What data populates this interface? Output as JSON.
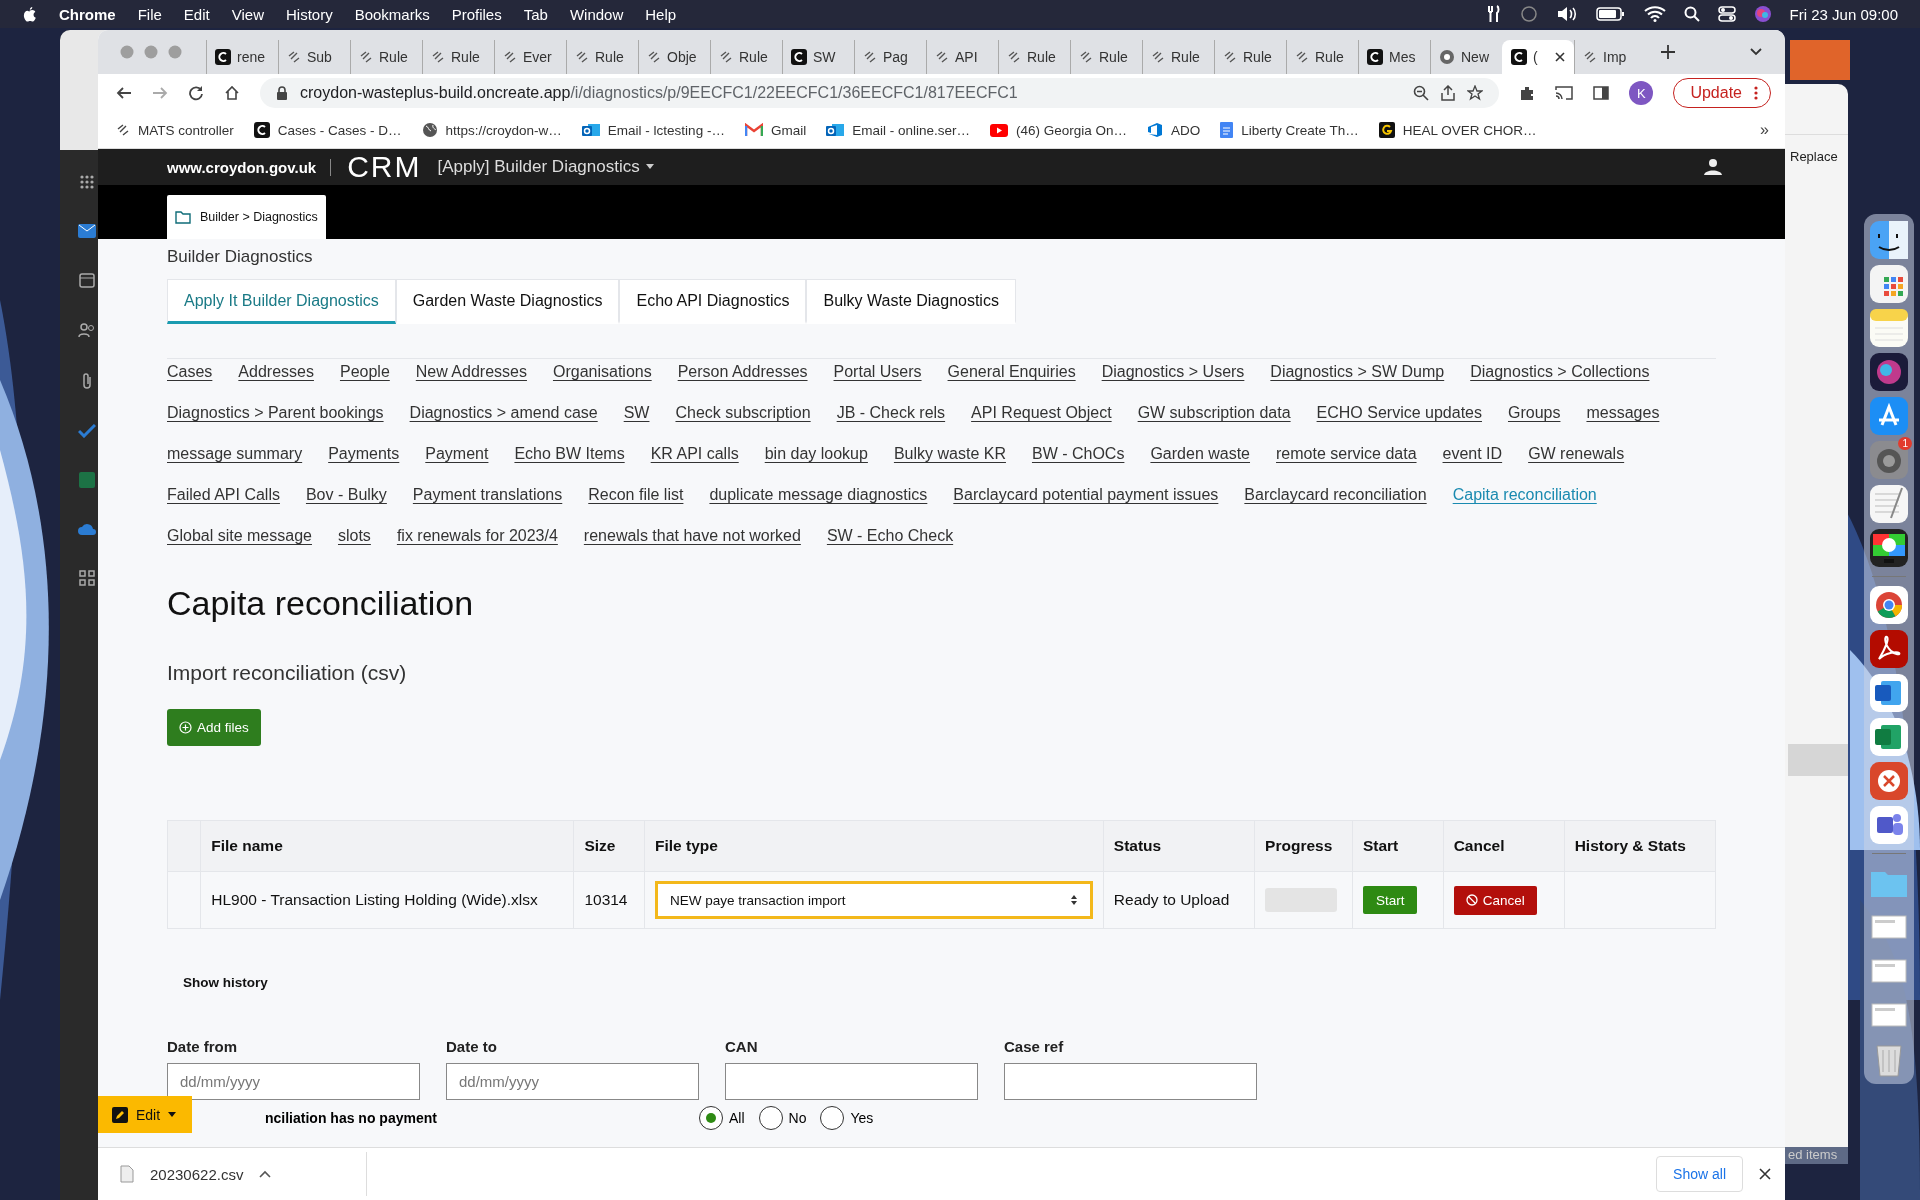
{
  "menu_bar": {
    "app": "Chrome",
    "items": [
      "File",
      "Edit",
      "View",
      "History",
      "Bookmarks",
      "Profiles",
      "Tab",
      "Window",
      "Help"
    ],
    "clock": "Fri 23 Jun  09:00"
  },
  "browser": {
    "tabs": [
      {
        "title": "rene",
        "kind": "c",
        "selected": false
      },
      {
        "title": "Sub",
        "kind": "rule",
        "selected": false
      },
      {
        "title": "Rule",
        "kind": "rule",
        "selected": false
      },
      {
        "title": "Rule",
        "kind": "rule",
        "selected": false
      },
      {
        "title": "Ever",
        "kind": "rule",
        "selected": false
      },
      {
        "title": "Rule",
        "kind": "rule",
        "selected": false
      },
      {
        "title": "Obje",
        "kind": "rule",
        "selected": false
      },
      {
        "title": "Rule",
        "kind": "rule",
        "selected": false
      },
      {
        "title": "SW",
        "kind": "c",
        "selected": false
      },
      {
        "title": "Pag",
        "kind": "rule",
        "selected": false
      },
      {
        "title": "API",
        "kind": "rule",
        "selected": false
      },
      {
        "title": "Rule",
        "kind": "rule",
        "selected": false
      },
      {
        "title": "Rule",
        "kind": "rule",
        "selected": false
      },
      {
        "title": "Rule",
        "kind": "rule",
        "selected": false
      },
      {
        "title": "Rule",
        "kind": "rule",
        "selected": false
      },
      {
        "title": "Rule",
        "kind": "rule",
        "selected": false
      },
      {
        "title": "Mes",
        "kind": "c",
        "selected": false
      },
      {
        "title": "New",
        "kind": "chrome",
        "selected": false
      },
      {
        "title": "(",
        "kind": "c",
        "selected": true
      },
      {
        "title": "Imp",
        "kind": "rule",
        "selected": false
      }
    ],
    "url_host": "croydon-wasteplus-build.oncreate.app",
    "url_path": "/i/diagnostics/p/9EECFC1/22EECFC1/36EECFC1/817EECFC1",
    "profile": "K",
    "update": "Update",
    "bookmarks": [
      {
        "title": "MATS controller",
        "kind": "rule"
      },
      {
        "title": "Cases - Cases - D…",
        "kind": "c"
      },
      {
        "title": "https://croydon-w…",
        "kind": "globe"
      },
      {
        "title": "Email - lctesting -…",
        "kind": "outlook"
      },
      {
        "title": "Gmail",
        "kind": "gmail"
      },
      {
        "title": "Email - online.ser…",
        "kind": "outlook"
      },
      {
        "title": "(46) Georgia On…",
        "kind": "youtube"
      },
      {
        "title": "ADO",
        "kind": "devops"
      },
      {
        "title": "Liberty Create Th…",
        "kind": "doc"
      },
      {
        "title": "HEAL OVER CHOR…",
        "kind": "g"
      }
    ],
    "more": "»"
  },
  "page": {
    "site": "www.croydon.gov.uk",
    "brand": "CRM",
    "app_menu": "[Apply] Builder Diagnostics",
    "breadcrumb": "Builder > Diagnostics",
    "section": "Builder Diagnostics",
    "tabs": [
      {
        "label": "Apply It Builder Diagnostics",
        "selected": true
      },
      {
        "label": "Garden Waste Diagnostics",
        "selected": false
      },
      {
        "label": "Echo API Diagnostics",
        "selected": false
      },
      {
        "label": "Bulky Waste Diagnostics",
        "selected": false
      }
    ],
    "links": [
      {
        "label": "Cases",
        "selected": false
      },
      {
        "label": "Addresses",
        "selected": false
      },
      {
        "label": "People",
        "selected": false
      },
      {
        "label": "New Addresses",
        "selected": false
      },
      {
        "label": "Organisations",
        "selected": false
      },
      {
        "label": "Person Addresses",
        "selected": false
      },
      {
        "label": "Portal Users",
        "selected": false
      },
      {
        "label": "General Enquiries",
        "selected": false
      },
      {
        "label": "Diagnostics > Users",
        "selected": false
      },
      {
        "label": "Diagnostics > SW Dump",
        "selected": false
      },
      {
        "label": "Diagnostics > Collections",
        "selected": false
      },
      {
        "label": "Diagnostics > Parent bookings",
        "selected": false
      },
      {
        "label": "Diagnostics > amend case",
        "selected": false
      },
      {
        "label": "SW",
        "selected": false
      },
      {
        "label": "Check subscription",
        "selected": false
      },
      {
        "label": "JB - Check rels",
        "selected": false
      },
      {
        "label": "API Request Object",
        "selected": false
      },
      {
        "label": "GW subscription data",
        "selected": false
      },
      {
        "label": "ECHO Service updates",
        "selected": false
      },
      {
        "label": "Groups",
        "selected": false
      },
      {
        "label": "messages",
        "selected": false
      },
      {
        "label": "message summary",
        "selected": false
      },
      {
        "label": "Payments",
        "selected": false
      },
      {
        "label": "Payment",
        "selected": false
      },
      {
        "label": "Echo BW Items",
        "selected": false
      },
      {
        "label": "KR API calls",
        "selected": false
      },
      {
        "label": "bin day lookup",
        "selected": false
      },
      {
        "label": "Bulky waste KR",
        "selected": false
      },
      {
        "label": "BW - ChOCs",
        "selected": false
      },
      {
        "label": "Garden waste",
        "selected": false
      },
      {
        "label": "remote service data",
        "selected": false
      },
      {
        "label": "event ID",
        "selected": false
      },
      {
        "label": "GW renewals",
        "selected": false
      },
      {
        "label": "Failed API Calls",
        "selected": false
      },
      {
        "label": "Bov - Bulky",
        "selected": false
      },
      {
        "label": "Payment translations",
        "selected": false
      },
      {
        "label": "Recon file list",
        "selected": false
      },
      {
        "label": "duplicate message diagnostics",
        "selected": false
      },
      {
        "label": "Barclaycard potential payment issues",
        "selected": false
      },
      {
        "label": "Barclaycard reconciliation",
        "selected": false
      },
      {
        "label": "Capita reconciliation",
        "selected": true
      },
      {
        "label": "Global site message",
        "selected": false
      },
      {
        "label": "slots",
        "selected": false
      },
      {
        "label": "fix renewals for 2023/4",
        "selected": false
      },
      {
        "label": "renewals that have not worked",
        "selected": false
      },
      {
        "label": "SW - Echo Check",
        "selected": false
      }
    ],
    "title": "Capita reconciliation",
    "import_heading": "Import reconciliation (csv)",
    "add_button": "Add files",
    "table": {
      "columns": [
        "File name",
        "Size",
        "File type",
        "Status",
        "Progress",
        "Start",
        "Cancel",
        "History & Stats"
      ],
      "rows": [
        {
          "file_name": "HL900 - Transaction Listing Holding (Wide).xlsx",
          "size": "10314",
          "file_type": "NEW paye transaction import",
          "status": "Ready to Upload",
          "level": 0,
          "start": "Start",
          "cancel": "Cancel"
        }
      ]
    },
    "show_history": "Show history",
    "filters": [
      {
        "label": "Date from",
        "placeholder": "dd/mm/yyyy"
      },
      {
        "label": "Date to",
        "placeholder": "dd/mm/yyyy"
      },
      {
        "label": "CAN"
      },
      {
        "label": "Case ref"
      }
    ],
    "payment_filter": {
      "label": "nciliation has no payment",
      "options": [
        {
          "label": "All",
          "selected": true
        },
        {
          "label": "No",
          "selected": false
        },
        {
          "label": "Yes",
          "selected": false
        }
      ]
    },
    "edit_button": "Edit"
  },
  "downloads": {
    "file": "20230622.csv",
    "show_all": "Show all"
  },
  "side_window": {
    "label": "Replace",
    "footer": "ed items"
  },
  "dock": {
    "groups": [
      [
        {
          "kind": "finder"
        },
        {
          "kind": "launchpad"
        },
        {
          "kind": "notes"
        },
        {
          "kind": "siri"
        },
        {
          "kind": "app-store"
        },
        {
          "kind": "settings",
          "badge": "1"
        },
        {
          "kind": "textedit"
        },
        {
          "kind": "recorder"
        }
      ],
      [
        {
          "kind": "chrome"
        },
        {
          "kind": "acrobat"
        },
        {
          "kind": "word"
        },
        {
          "kind": "excel"
        },
        {
          "kind": "remote"
        },
        {
          "kind": "teams"
        }
      ],
      [
        {
          "kind": "folder"
        },
        {
          "kind": "thumb"
        },
        {
          "kind": "thumb"
        },
        {
          "kind": "thumb"
        },
        {
          "kind": "trash"
        }
      ]
    ]
  }
}
